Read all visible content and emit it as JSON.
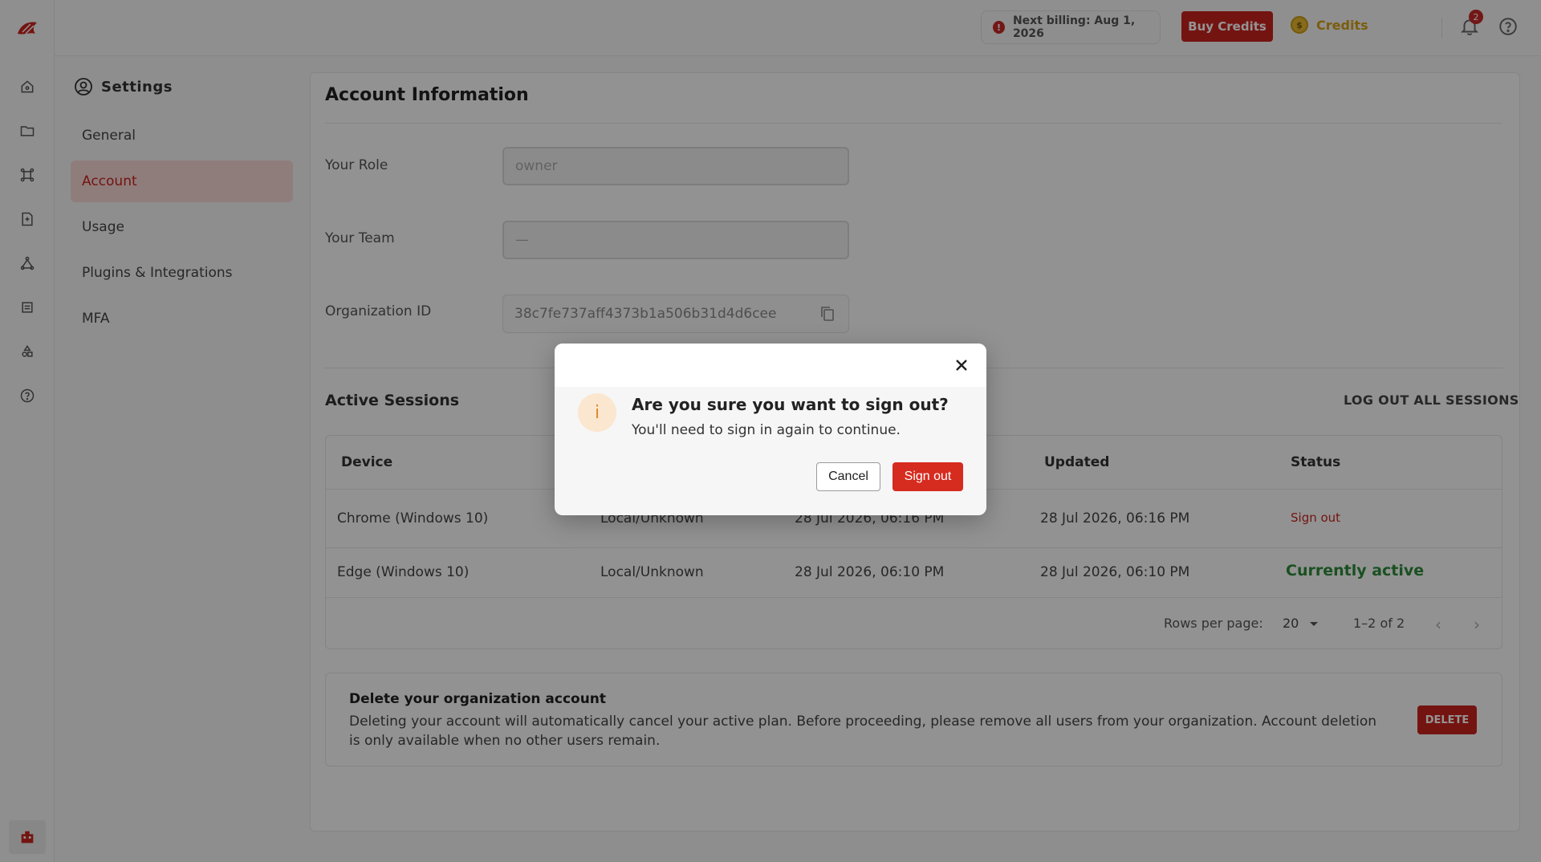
{
  "topbar": {
    "billing_text": "Next billing: Aug 1, 2026",
    "billing_icon": "!",
    "buy_credits": "Buy Credits",
    "credits_label": "Credits",
    "credits_coin": "$",
    "notification_count": "2"
  },
  "settings": {
    "title": "Settings",
    "nav": [
      {
        "label": "General"
      },
      {
        "label": "Account"
      },
      {
        "label": "Usage"
      },
      {
        "label": "Plugins & Integrations"
      },
      {
        "label": "MFA"
      }
    ]
  },
  "account": {
    "title": "Account Information",
    "role_label": "Your Role",
    "role_value": "owner",
    "team_label": "Your Team",
    "team_value": "—",
    "org_label": "Organization ID",
    "org_value": "38c7fe737aff4373b1a506b31d4d6cee"
  },
  "sessions": {
    "title": "Active Sessions",
    "logout_all": "LOG OUT ALL SESSIONS",
    "headers": {
      "device": "Device",
      "updated": "Updated",
      "status": "Status"
    },
    "rows": [
      {
        "device": "Chrome (Windows 10)",
        "location": "Local/Unknown",
        "created": "28 Jul 2026, 06:16 PM",
        "updated": "28 Jul 2026, 06:16 PM",
        "status": "Sign out"
      },
      {
        "device": "Edge (Windows 10)",
        "location": "Local/Unknown",
        "created": "28 Jul 2026, 06:10 PM",
        "updated": "28 Jul 2026, 06:10 PM",
        "status": "Currently active"
      }
    ],
    "rows_per_page_label": "Rows per page:",
    "rows_per_page_value": "20",
    "range": "1–2 of 2"
  },
  "delete_section": {
    "title": "Delete your organization account",
    "text": "Deleting your account will automatically cancel your active plan. Before proceeding, please remove all users from your organization. Account deletion is only available when no other users remain.",
    "button": "DELETE"
  },
  "dialog": {
    "question": "Are you sure you want to sign out?",
    "subtext": "You'll need to sign in again to continue.",
    "info_glyph": "i",
    "cancel": "Cancel",
    "confirm": "Sign out"
  },
  "colors": {
    "brand_red": "#c8241e",
    "active_green": "#2e8b3a",
    "credits_gold": "#d4a017"
  }
}
